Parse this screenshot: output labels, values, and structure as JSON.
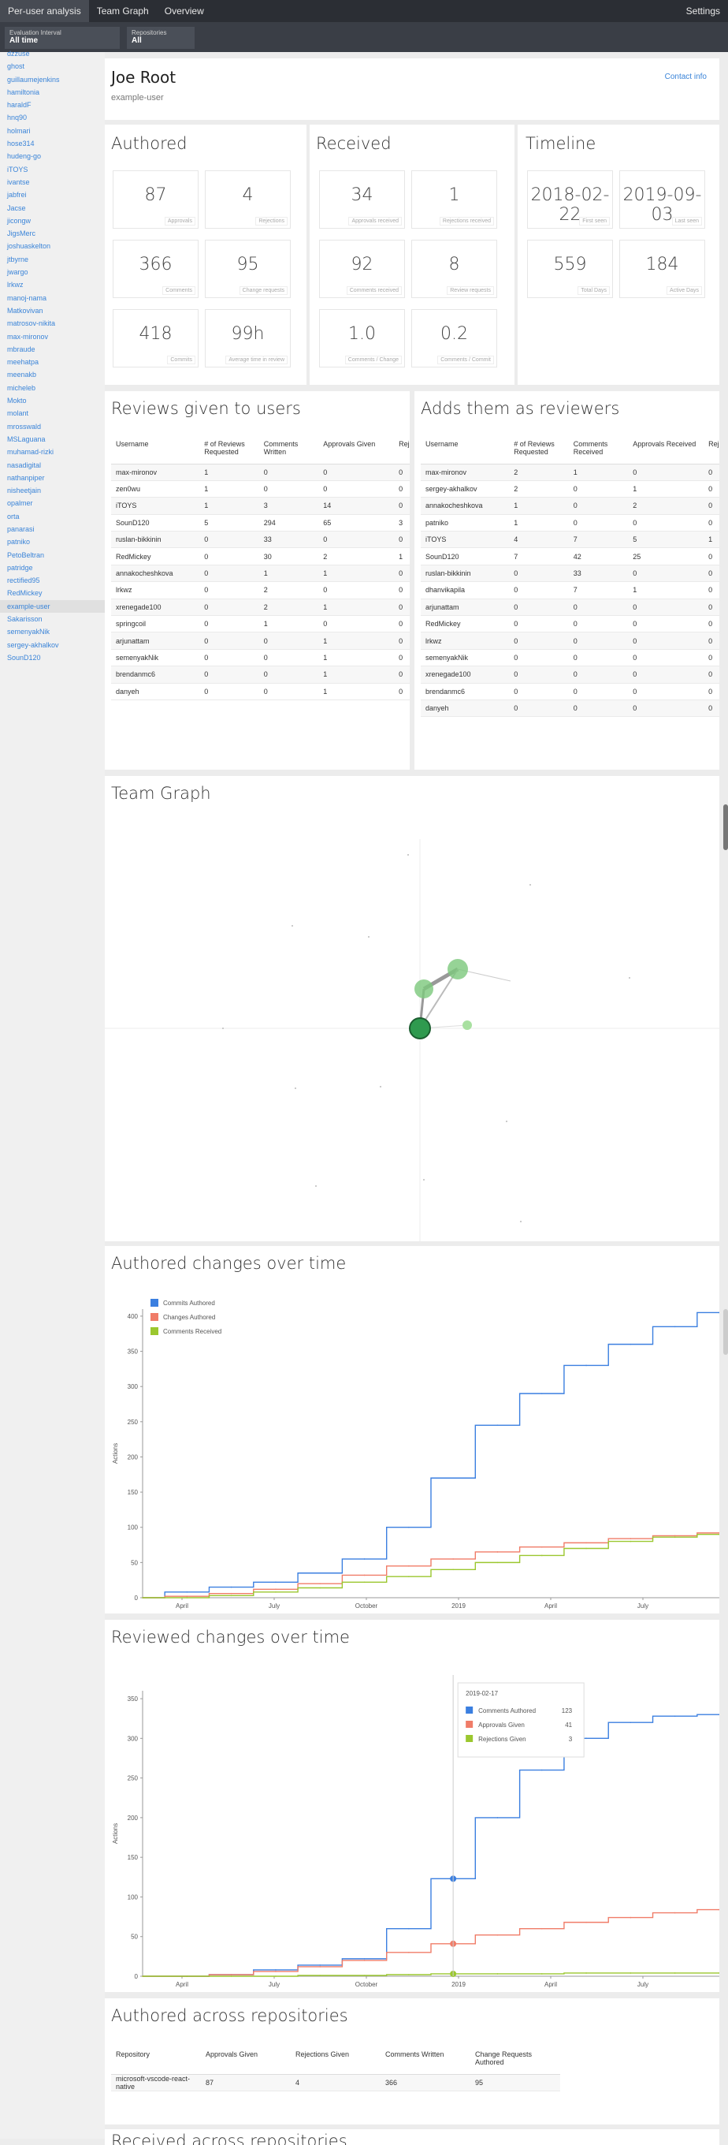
{
  "nav": {
    "tabs": [
      {
        "label": "Per-user analysis"
      },
      {
        "label": "Team Graph"
      },
      {
        "label": "Overview"
      }
    ],
    "settings_label": "Settings"
  },
  "filters": {
    "interval_label": "Evaluation Interval",
    "interval_value": "All time",
    "repos_label": "Repositories",
    "repos_value": "All"
  },
  "sidebar": {
    "items": [
      "dzzuse",
      "ghost",
      "guillaumejenkins",
      "hamiltonia",
      "haraldF",
      "hnq90",
      "holmari",
      "hose314",
      "hudeng-go",
      "iTOYS",
      "ivantse",
      "jabfrei",
      "Jacse",
      "jicongw",
      "JigsMerc",
      "joshuaskelton",
      "jtbyrne",
      "jwargo",
      "lrkwz",
      "manoj-nama",
      "Matkovivan",
      "matrosov-nikita",
      "max-mironov",
      "mbraude",
      "meehatpa",
      "meenakb",
      "micheleb",
      "Mokto",
      "molant",
      "mrosswald",
      "MSLaguana",
      "muhamad-rizki",
      "nasadigital",
      "nathanpiper",
      "nisheetjain",
      "opalmer",
      "orta",
      "panarasi",
      "patniko",
      "PetoBeltran",
      "patridge",
      "rectified95",
      "RedMickey",
      "example-user",
      "Sakarisson",
      "semenyakNik",
      "sergey-akhalkov",
      "SounD120"
    ],
    "active_index": 43
  },
  "profile": {
    "name": "Joe Root",
    "username": "example-user",
    "contact_label": "Contact info"
  },
  "authored": {
    "title": "Authored",
    "stats": [
      {
        "value": "87",
        "label": "Approvals"
      },
      {
        "value": "4",
        "label": "Rejections"
      },
      {
        "value": "366",
        "label": "Comments"
      },
      {
        "value": "95",
        "label": "Change requests"
      },
      {
        "value": "418",
        "label": "Commits"
      },
      {
        "value": "99h",
        "label": "Average time in review"
      }
    ]
  },
  "received": {
    "title": "Received",
    "stats": [
      {
        "value": "34",
        "label": "Approvals received"
      },
      {
        "value": "1",
        "label": "Rejections received"
      },
      {
        "value": "92",
        "label": "Comments received"
      },
      {
        "value": "8",
        "label": "Review requests"
      },
      {
        "value": "1.0",
        "label": "Comments / Change"
      },
      {
        "value": "0.2",
        "label": "Comments / Commit"
      }
    ]
  },
  "timeline": {
    "title": "Timeline",
    "stats": [
      {
        "value": "2018-02-22",
        "label": "First seen"
      },
      {
        "value": "2019-09-03",
        "label": "Last seen"
      },
      {
        "value": "559",
        "label": "Total Days"
      },
      {
        "value": "184",
        "label": "Active Days"
      }
    ]
  },
  "reviews_given": {
    "title": "Reviews given to users",
    "headers": [
      "Username",
      "# of Reviews Requested",
      "Comments Written",
      "Approvals Given",
      "Reject"
    ],
    "rows": [
      [
        "max-mironov",
        "1",
        "0",
        "0",
        "0"
      ],
      [
        "zen0wu",
        "1",
        "0",
        "0",
        "0"
      ],
      [
        "iTOYS",
        "1",
        "3",
        "14",
        "0"
      ],
      [
        "SounD120",
        "5",
        "294",
        "65",
        "3"
      ],
      [
        "ruslan-bikkinin",
        "0",
        "33",
        "0",
        "0"
      ],
      [
        "RedMickey",
        "0",
        "30",
        "2",
        "1"
      ],
      [
        "annakocheshkova",
        "0",
        "1",
        "1",
        "0"
      ],
      [
        "lrkwz",
        "0",
        "2",
        "0",
        "0"
      ],
      [
        "xrenegade100",
        "0",
        "2",
        "1",
        "0"
      ],
      [
        "springcoil",
        "0",
        "1",
        "0",
        "0"
      ],
      [
        "arjunattam",
        "0",
        "0",
        "1",
        "0"
      ],
      [
        "semenyakNik",
        "0",
        "0",
        "1",
        "0"
      ],
      [
        "brendanmc6",
        "0",
        "0",
        "1",
        "0"
      ],
      [
        "danyeh",
        "0",
        "0",
        "1",
        "0"
      ]
    ]
  },
  "adds_reviewers": {
    "title": "Adds them as reviewers",
    "headers": [
      "Username",
      "# of Reviews Requested",
      "Comments Received",
      "Approvals Received",
      "Reject"
    ],
    "rows": [
      [
        "max-mironov",
        "2",
        "1",
        "0",
        "0"
      ],
      [
        "sergey-akhalkov",
        "2",
        "0",
        "1",
        "0"
      ],
      [
        "annakocheshkova",
        "1",
        "0",
        "2",
        "0"
      ],
      [
        "patniko",
        "1",
        "0",
        "0",
        "0"
      ],
      [
        "iTOYS",
        "4",
        "7",
        "5",
        "1"
      ],
      [
        "SounD120",
        "7",
        "42",
        "25",
        "0"
      ],
      [
        "ruslan-bikkinin",
        "0",
        "33",
        "0",
        "0"
      ],
      [
        "dhanvikapila",
        "0",
        "7",
        "1",
        "0"
      ],
      [
        "arjunattam",
        "0",
        "0",
        "0",
        "0"
      ],
      [
        "RedMickey",
        "0",
        "0",
        "0",
        "0"
      ],
      [
        "lrkwz",
        "0",
        "0",
        "0",
        "0"
      ],
      [
        "semenyakNik",
        "0",
        "0",
        "0",
        "0"
      ],
      [
        "xrenegade100",
        "0",
        "0",
        "0",
        "0"
      ],
      [
        "brendanmc6",
        "0",
        "0",
        "0",
        "0"
      ],
      [
        "danyeh",
        "0",
        "0",
        "0",
        "0"
      ]
    ]
  },
  "team_graph": {
    "title": "Team Graph"
  },
  "authored_chart_section": {
    "title": "Authored changes over time"
  },
  "reviewed_chart_section": {
    "title": "Reviewed changes over time"
  },
  "repos": {
    "title": "Authored across repositories",
    "headers": [
      "Repository",
      "Approvals Given",
      "Rejections Given",
      "Comments Written",
      "Change Requests Authored"
    ],
    "rows": [
      [
        "microsoft-vscode-react-native",
        "87",
        "4",
        "366",
        "95"
      ]
    ]
  },
  "next_section_title": "Received across repositories",
  "chart_data": [
    {
      "type": "line",
      "title": "Authored changes over time",
      "ylabel": "Actions",
      "xlabel": "",
      "x_ticks": [
        "April",
        "July",
        "October",
        "2019",
        "April",
        "July"
      ],
      "ylim": [
        0,
        410
      ],
      "y_ticks": [
        0,
        50,
        100,
        150,
        200,
        250,
        300,
        350,
        400
      ],
      "legend": "top-left",
      "grid": false,
      "x": [
        "2018-02",
        "2018-04",
        "2018-06",
        "2018-08",
        "2018-10",
        "2018-12",
        "2019-02",
        "2019-03",
        "2019-04",
        "2019-05",
        "2019-06",
        "2019-07",
        "2019-08",
        "2019-09"
      ],
      "series": [
        {
          "name": "Commits Authored",
          "color": "#3b7fe0",
          "values": [
            0,
            8,
            15,
            22,
            35,
            55,
            100,
            170,
            245,
            290,
            330,
            360,
            385,
            405
          ]
        },
        {
          "name": "Changes Authored",
          "color": "#f07c68",
          "values": [
            0,
            2,
            6,
            12,
            20,
            32,
            45,
            55,
            65,
            72,
            78,
            84,
            88,
            92
          ]
        },
        {
          "name": "Comments Received",
          "color": "#9bc72f",
          "values": [
            0,
            0,
            3,
            8,
            14,
            22,
            30,
            40,
            50,
            60,
            70,
            80,
            86,
            90
          ]
        }
      ]
    },
    {
      "type": "line",
      "title": "Reviewed changes over time",
      "ylabel": "Actions",
      "xlabel": "",
      "x_ticks": [
        "April",
        "July",
        "October",
        "2019",
        "April",
        "July"
      ],
      "ylim": [
        0,
        360
      ],
      "y_ticks": [
        0,
        50,
        100,
        150,
        200,
        250,
        300,
        350
      ],
      "legend": "none",
      "grid": false,
      "tooltip": {
        "date": "2019-02-17",
        "items": [
          {
            "label": "Comments Authored",
            "value": "123"
          },
          {
            "label": "Approvals Given",
            "value": "41"
          },
          {
            "label": "Rejections Given",
            "value": "3"
          }
        ]
      },
      "x": [
        "2018-02",
        "2018-04",
        "2018-06",
        "2018-08",
        "2018-10",
        "2018-12",
        "2019-01",
        "2019-02",
        "2019-03",
        "2019-04",
        "2019-05",
        "2019-06",
        "2019-07",
        "2019-09"
      ],
      "series": [
        {
          "name": "Comments Authored",
          "color": "#3b7fe0",
          "values": [
            0,
            0,
            2,
            8,
            14,
            22,
            60,
            123,
            200,
            260,
            300,
            320,
            328,
            330
          ]
        },
        {
          "name": "Approvals Given",
          "color": "#f07c68",
          "values": [
            0,
            0,
            2,
            6,
            12,
            20,
            30,
            41,
            52,
            60,
            68,
            74,
            80,
            84
          ]
        },
        {
          "name": "Rejections Given",
          "color": "#9bc72f",
          "values": [
            0,
            0,
            0,
            0,
            1,
            1,
            2,
            3,
            3,
            3,
            4,
            4,
            4,
            4
          ]
        }
      ]
    }
  ]
}
